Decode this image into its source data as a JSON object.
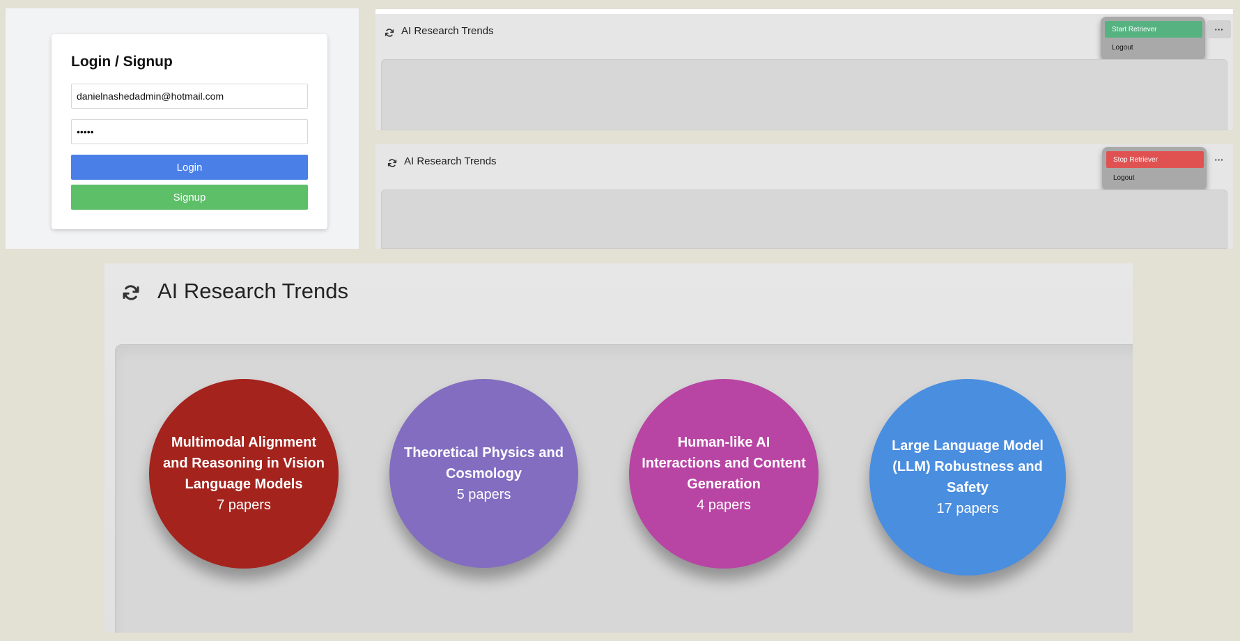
{
  "login": {
    "title": "Login / Signup",
    "email_value": "danielnashedadmin@hotmail.com",
    "password_value": "•••••",
    "login_label": "Login",
    "signup_label": "Signup"
  },
  "app": {
    "title": "AI Research Trends",
    "menu_more_label": "···",
    "logout_label": "Logout"
  },
  "mini_panels": [
    {
      "retriever_label": "Start Retriever",
      "retriever_color": "#56b281"
    },
    {
      "retriever_label": "Stop Retriever",
      "retriever_color": "#e05252"
    }
  ],
  "topics": [
    {
      "title": "Multimodal Alignment and Reasoning in Vision Language Models",
      "count": "7 papers",
      "color": "#a4231d"
    },
    {
      "title": "Theoretical Physics and Cosmology",
      "count": "5 papers",
      "color": "#826dc1"
    },
    {
      "title": "Human-like AI Interactions and Content Generation",
      "count": "4 papers",
      "color": "#b844a3"
    },
    {
      "title": "Large Language Model (LLM) Robustness and Safety",
      "count": "17 papers",
      "color": "#4a8ee0"
    }
  ],
  "icons": {
    "refresh": "refresh-icon",
    "more": "more-horizontal-icon"
  }
}
